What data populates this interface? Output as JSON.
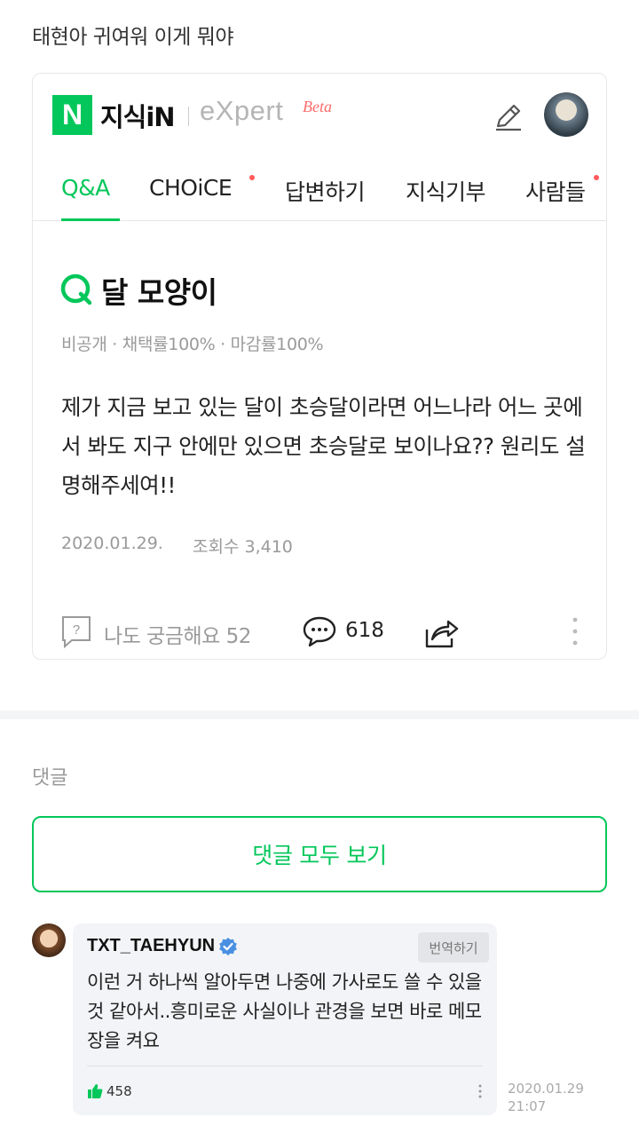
{
  "post": {
    "title": "태현아 귀여워 이게 뭐야"
  },
  "header": {
    "logo_letter": "N",
    "logo_text": "지식iN",
    "expert_text": "eXpert",
    "beta_text": "Beta"
  },
  "tabs": [
    {
      "label": "Q&A",
      "active": true
    },
    {
      "label": "CHOiCE",
      "dot": true
    },
    {
      "label": "답변하기"
    },
    {
      "label": "지식기부"
    },
    {
      "label": "사람들",
      "dot": true
    }
  ],
  "question": {
    "title": "달 모양이",
    "meta": "비공개 · 채택률100% · 마감률100%",
    "body": "제가 지금 보고 있는 달이 초승달이라면 어느나라 어느 곳에서 봐도 지구 안에만 있으면 초승달로 보이나요?? 원리도 설명해주세여!!",
    "date": "2020.01.29.",
    "views": "조회수 3,410"
  },
  "actions": {
    "curious_label": "나도 궁금해요 52",
    "comment_count": "618"
  },
  "comments": {
    "heading": "댓글",
    "all_button": "댓글 모두 보기",
    "items": [
      {
        "user": "TXT_TAEHYUN",
        "translate_label": "번역하기",
        "text": "이런 거 하나씩 알아두면 나중에 가사로도 쓸 수 있을 것 같아서..흥미로운 사실이나 관경을 보면 바로 메모장을 켜요",
        "likes": "458",
        "time": "2020.01.29 21:07"
      }
    ]
  },
  "colors": {
    "accent": "#03c75a",
    "tab_dot": "#ff5a5a",
    "beta": "#ff6b6b",
    "verified": "#4a90e2"
  }
}
